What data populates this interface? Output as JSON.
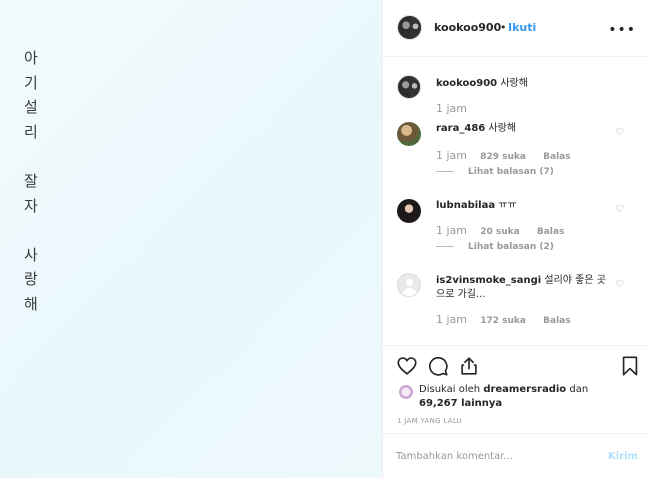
{
  "photo": {
    "lines": [
      "아",
      "기",
      "설",
      "리",
      "",
      "잘",
      "자",
      "",
      "사",
      "랑",
      "해"
    ]
  },
  "header": {
    "username": "kookoo900",
    "separator": "•",
    "follow": "Ikuti",
    "more_icon": "more-horizontal-icon"
  },
  "comments": [
    {
      "username": "kookoo900",
      "text": "사랑해",
      "time": "1 jam"
    },
    {
      "username": "rara_486",
      "text": "사랑해",
      "time": "1 jam",
      "likes": "829 suka",
      "reply": "Balas",
      "view_replies": "Lihat balasan (7)"
    },
    {
      "username": "lubnabilaa",
      "text": "ㅠㅠ",
      "time": "1 jam",
      "likes": "20 suka",
      "reply": "Balas",
      "view_replies": "Lihat balasan (2)"
    },
    {
      "username": "is2vinsmoke_sangi",
      "text": "설리야 좋은 곳으로 가길...",
      "time": "1 jam",
      "likes": "172 suka",
      "reply": "Balas"
    }
  ],
  "actions": {
    "icons": [
      "heart-icon",
      "comment-icon",
      "share-icon",
      "bookmark-icon"
    ],
    "liked_prefix": "Disukai oleh",
    "liked_by": "dreamersradio",
    "liked_joiner": "dan",
    "liked_count": "69,267 lainnya",
    "timestamp": "1 JAM YANG LALU"
  },
  "add_comment": {
    "placeholder": "Tambahkan komentar...",
    "post": "Kirim"
  }
}
